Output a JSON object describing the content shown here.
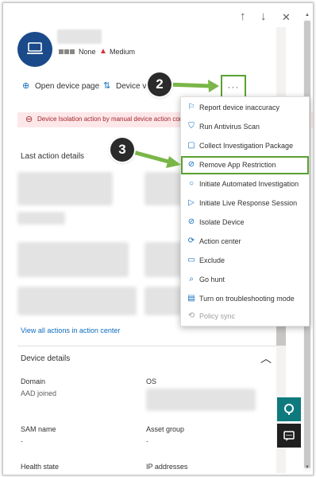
{
  "nav": {
    "up_icon": "↑",
    "down_icon": "↓",
    "close_icon": "✕"
  },
  "device": {
    "risk_level": "None",
    "exposure_icon": "▲",
    "exposure_level": "Medium"
  },
  "actions": {
    "open_device_page": "Open device page",
    "device_value": "Device v",
    "more_label": "···"
  },
  "alert": {
    "text_left": "Device Isolation action by manual device action com",
    "text_right": ""
  },
  "last_action": {
    "title": "Last action details",
    "view_all": "View all actions in action center"
  },
  "device_details": {
    "title": "Device details",
    "fields": [
      {
        "label": "Domain",
        "value": "AAD joined"
      },
      {
        "label": "OS",
        "value": ""
      },
      {
        "label": "SAM name",
        "value": "-"
      },
      {
        "label": "Asset group",
        "value": "-"
      },
      {
        "label": "Health state",
        "value": ""
      },
      {
        "label": "IP addresses",
        "value": ""
      }
    ]
  },
  "menu": {
    "items": [
      {
        "icon": "report-icon",
        "glyph": "⚐",
        "label": "Report device inaccuracy"
      },
      {
        "icon": "shield-icon",
        "glyph": "⛉",
        "label": "Run Antivirus Scan"
      },
      {
        "icon": "package-icon",
        "glyph": "▢",
        "label": "Collect Investigation Package"
      },
      {
        "icon": "app-restriction-icon",
        "glyph": "⊘",
        "label": "Remove App Restriction"
      },
      {
        "icon": "investigation-icon",
        "glyph": "○",
        "label": "Initiate Automated Investigation"
      },
      {
        "icon": "play-icon",
        "glyph": "▷",
        "label": "Initiate Live Response Session"
      },
      {
        "icon": "isolate-icon",
        "glyph": "⊘",
        "label": "Isolate Device"
      },
      {
        "icon": "action-center-icon",
        "glyph": "⟳",
        "label": "Action center"
      },
      {
        "icon": "exclude-icon",
        "glyph": "▭",
        "label": "Exclude"
      },
      {
        "icon": "hunt-icon",
        "glyph": "⌕",
        "label": "Go hunt"
      },
      {
        "icon": "troubleshoot-icon",
        "glyph": "▤",
        "label": "Turn on troubleshooting mode"
      },
      {
        "icon": "sync-icon",
        "glyph": "⟲",
        "label": "Policy sync"
      }
    ]
  },
  "callouts": {
    "step_two": "2",
    "step_three": "3"
  },
  "colors": {
    "accent": "#0f6cbd",
    "highlight_green": "#5aa132",
    "alert_bg": "#fde7e9",
    "avatar_bg": "#1b4a8a"
  }
}
